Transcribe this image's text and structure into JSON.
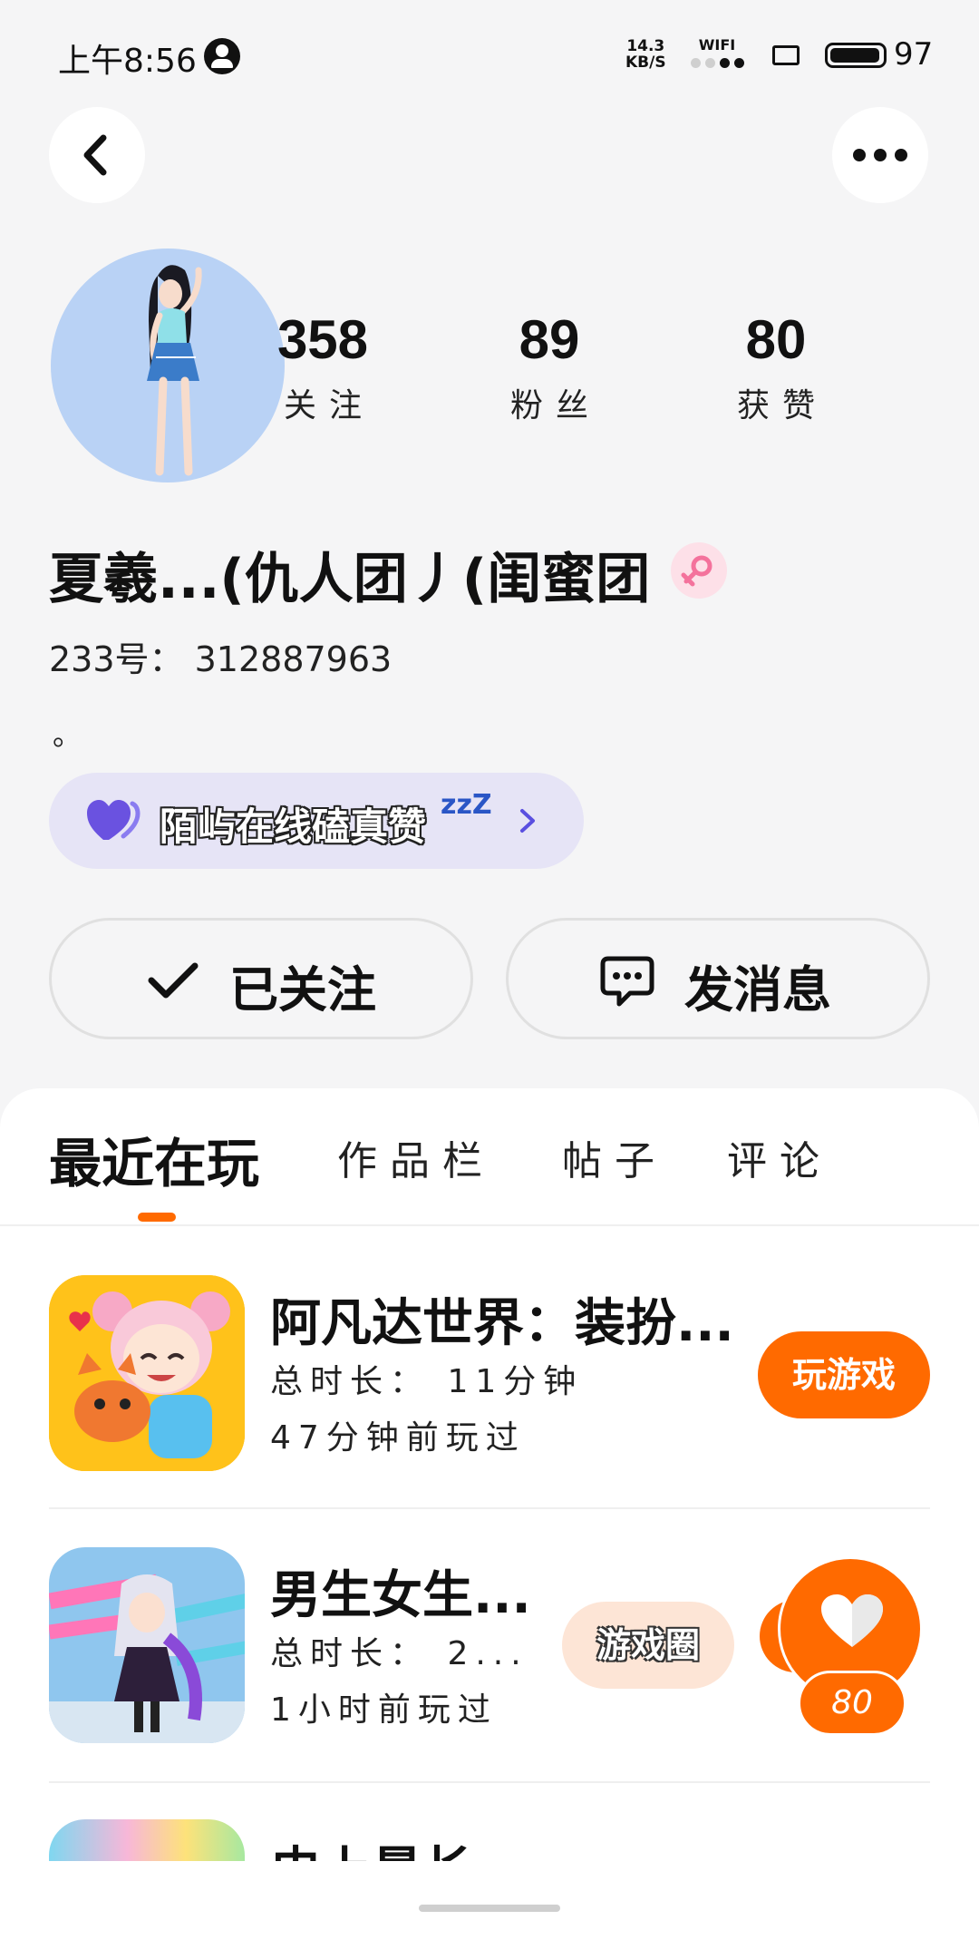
{
  "status_bar": {
    "time": "上午8:56",
    "network_speed_value": "14.3",
    "network_speed_unit": "KB/S",
    "wifi_label": "WIFI",
    "battery_level": "97",
    "battery_fraction": 0.97
  },
  "profile": {
    "stats": [
      {
        "value": "358",
        "label": "关注"
      },
      {
        "value": "89",
        "label": "粉丝"
      },
      {
        "value": "80",
        "label": "获赞"
      }
    ],
    "username": "夏羲...(仇人团丿(闺蜜团",
    "user_id": "233号：  312887963",
    "bio": "。",
    "group": {
      "label": "陌屿在线磕真赞",
      "zzz": "zzZ"
    }
  },
  "actions": {
    "follow_label": "已关注",
    "message_label": "发消息"
  },
  "tabs": [
    {
      "label": "最近在玩",
      "active": true
    },
    {
      "label": "作品栏",
      "active": false
    },
    {
      "label": "帖子",
      "active": false
    },
    {
      "label": "评论",
      "active": false
    }
  ],
  "games": [
    {
      "title": "阿凡达世界：装扮...",
      "duration": "总时长：  11分钟",
      "last_played": "47分钟前玩过",
      "button_label": "玩游戏"
    },
    {
      "title": "男生女生...",
      "duration": "总时长：  2...",
      "last_played": "1小时前玩过",
      "button_label": "游戏圈"
    },
    {
      "title": "史上最长"
    }
  ],
  "like_fab": {
    "count": "80"
  },
  "colors": {
    "accent": "#ff6a00",
    "background": "#f5f5f6",
    "group_pill": "#e6e4f6",
    "avatar_bg": "#b9d2f5"
  }
}
